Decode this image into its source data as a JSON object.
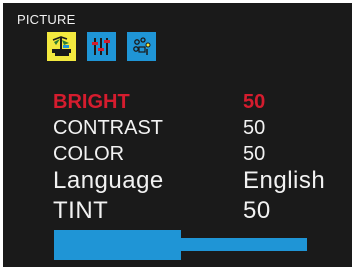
{
  "menu": {
    "title": "PICTURE",
    "icons": [
      {
        "name": "picture-icon",
        "selected": true
      },
      {
        "name": "sound-icon",
        "selected": false
      },
      {
        "name": "setup-icon",
        "selected": false
      }
    ]
  },
  "settings": [
    {
      "label": "BRIGHT",
      "value": "50",
      "selected": true
    },
    {
      "label": "CONTRAST",
      "value": "50",
      "selected": false
    },
    {
      "label": "COLOR",
      "value": "50",
      "selected": false
    },
    {
      "label": "Language",
      "value": "English",
      "selected": false
    },
    {
      "label": "TINT",
      "value": "50",
      "selected": false
    }
  ],
  "level_bar": {
    "fraction": 0.5
  },
  "colors": {
    "background": "#1a1a1a",
    "text": "#f2f2f2",
    "selected_text": "#d51c2e",
    "accent_blue": "#1f95d6",
    "selected_border": "#f3e93f"
  }
}
